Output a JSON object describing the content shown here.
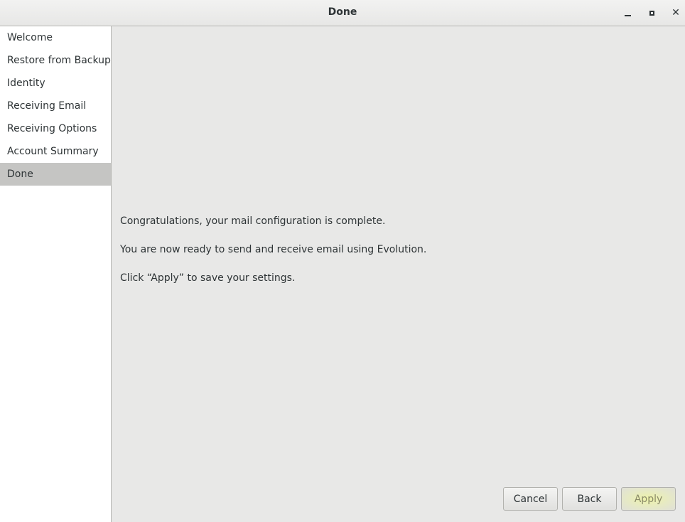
{
  "window": {
    "title": "Done",
    "controls": [
      "minimize-icon",
      "maximize-icon",
      "close-icon"
    ],
    "close_glyph": "✕"
  },
  "sidebar": {
    "items": [
      {
        "label": "Welcome",
        "selected": false
      },
      {
        "label": "Restore from Backup",
        "selected": false
      },
      {
        "label": "Identity",
        "selected": false
      },
      {
        "label": "Receiving Email",
        "selected": false
      },
      {
        "label": "Receiving Options",
        "selected": false
      },
      {
        "label": "Account Summary",
        "selected": false
      },
      {
        "label": "Done",
        "selected": true
      }
    ]
  },
  "main": {
    "messages": [
      "Congratulations, your mail configuration is complete.",
      "You are now ready to send and receive email using Evolution.",
      "Click “Apply” to save your settings."
    ]
  },
  "buttons": {
    "cancel": "Cancel",
    "back": "Back",
    "apply": "Apply"
  },
  "colors": {
    "selected_item_bg": "#c5c5c3",
    "content_bg": "#e8e8e7",
    "apply_highlight": "#eef3a8"
  }
}
